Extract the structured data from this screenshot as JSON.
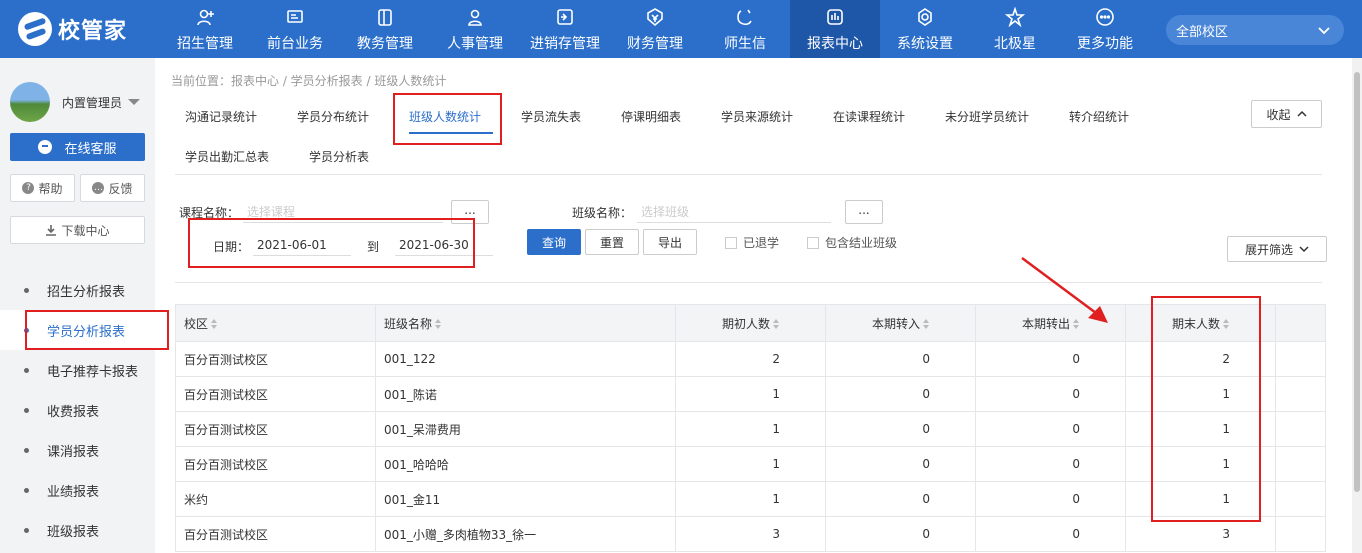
{
  "header": {
    "logo_text": "校管家",
    "nav": [
      {
        "label": "招生管理",
        "icon": "user-plus-icon"
      },
      {
        "label": "前台业务",
        "icon": "monitor-icon"
      },
      {
        "label": "教务管理",
        "icon": "book-icon"
      },
      {
        "label": "人事管理",
        "icon": "person-icon"
      },
      {
        "label": "进销存管理",
        "icon": "inventory-icon"
      },
      {
        "label": "财务管理",
        "icon": "yen-shield-icon"
      },
      {
        "label": "师生信",
        "icon": "chat-icon"
      },
      {
        "label": "报表中心",
        "icon": "chart-icon",
        "active": true
      },
      {
        "label": "系统设置",
        "icon": "gear-icon"
      },
      {
        "label": "北极星",
        "icon": "star-icon"
      },
      {
        "label": "更多功能",
        "icon": "more-icon"
      }
    ],
    "campus_select": "全部校区"
  },
  "sidebar": {
    "user_name": "内置管理员",
    "service_label": "在线客服",
    "help_label": "帮助",
    "feedback_label": "反馈",
    "download_label": "下载中心",
    "menu": [
      {
        "label": "招生分析报表"
      },
      {
        "label": "学员分析报表",
        "active": true
      },
      {
        "label": "电子推荐卡报表"
      },
      {
        "label": "收费报表"
      },
      {
        "label": "课消报表"
      },
      {
        "label": "业绩报表"
      },
      {
        "label": "班级报表"
      }
    ]
  },
  "main": {
    "breadcrumb": "当前位置：报表中心 / 学员分析报表 / 班级人数统计",
    "tabs": [
      "沟通记录统计",
      "学员分布统计",
      "班级人数统计",
      "学员流失表",
      "停课明细表",
      "学员来源统计",
      "在读课程统计",
      "未分班学员统计",
      "转介绍统计",
      "学员出勤汇总表",
      "学员分析表"
    ],
    "active_tab": "班级人数统计",
    "collapse_label": "收起",
    "filters": {
      "course_label": "课程名称：",
      "course_placeholder": "选择课程",
      "class_label": "班级名称：",
      "class_placeholder": "选择班级",
      "dots": "...",
      "date_label": "日期：",
      "date_from": "2021-06-01",
      "date_to_label": "到",
      "date_to": "2021-06-30",
      "query_label": "查询",
      "reset_label": "重置",
      "export_label": "导出",
      "withdrawn_label": "已退学",
      "graduated_label": "包含结业班级",
      "expand_label": "展开筛选"
    },
    "table": {
      "columns": [
        "校区",
        "班级名称",
        "期初人数",
        "本期转入",
        "本期转出",
        "期末人数"
      ],
      "rows": [
        [
          "百分百测试校区",
          "001_122",
          "2",
          "0",
          "0",
          "2"
        ],
        [
          "百分百测试校区",
          "001_陈诺",
          "1",
          "0",
          "0",
          "1"
        ],
        [
          "百分百测试校区",
          "001_呆滞费用",
          "1",
          "0",
          "0",
          "1"
        ],
        [
          "百分百测试校区",
          "001_哈哈哈",
          "1",
          "0",
          "0",
          "1"
        ],
        [
          "米约",
          "001_金11",
          "1",
          "0",
          "0",
          "1"
        ],
        [
          "百分百测试校区",
          "001_小赠_多肉植物33_徐一",
          "3",
          "0",
          "0",
          "3"
        ]
      ]
    }
  }
}
